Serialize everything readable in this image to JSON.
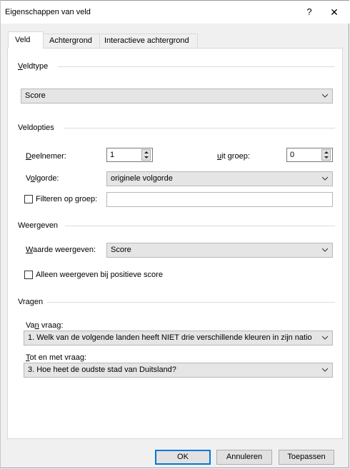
{
  "window": {
    "title": "Eigenschappen van veld",
    "help_glyph": "?",
    "close_glyph": "✕"
  },
  "tabs": [
    {
      "label": "Veld",
      "active": true
    },
    {
      "label": "Achtergrond",
      "active": false
    },
    {
      "label": "Interactieve achtergrond",
      "active": false
    }
  ],
  "veldtype": {
    "title_u": "V",
    "title_rest": "eldtype",
    "selected": "Score"
  },
  "veldopties": {
    "title": "Veldopties",
    "deelnemer_u": "D",
    "deelnemer_rest": "eelnemer:",
    "deelnemer_value": "1",
    "uitgroep_u": "u",
    "uitgroep_rest": "it groep:",
    "uitgroep_value": "0",
    "volgorde_a": "V",
    "volgorde_u": "o",
    "volgorde_rest": "lgorde:",
    "volgorde_selected": "originele volgorde",
    "filteren_label": "Filteren op groep:",
    "filteren_checked": false,
    "filteren_value": ""
  },
  "weergeven": {
    "title": "Weergeven",
    "waarde_u": "W",
    "waarde_rest": "aarde weergeven:",
    "waarde_selected": "Score",
    "positief_label": "Alleen weergeven bij positieve score",
    "positief_checked": false
  },
  "vragen": {
    "title": "Vragen",
    "van_a": "Va",
    "van_u": "n",
    "van_rest": " vraag:",
    "van_selected": "1. Welk van de volgende landen heeft NIET drie verschillende kleuren in zijn natio",
    "tot_u": "T",
    "tot_rest": "ot en met vraag:",
    "tot_selected": "3. Hoe heet de oudste stad van Duitsland?"
  },
  "buttons": {
    "ok": "OK",
    "cancel": "Annuleren",
    "apply": "Toepassen"
  },
  "colors": {
    "accent": "#0078d7",
    "combo_bg": "#e5e5e5",
    "dialog_bg": "#f0f0f0"
  }
}
